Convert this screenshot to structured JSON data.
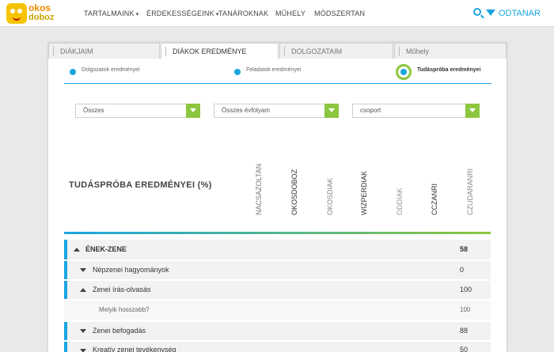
{
  "logo": {
    "word1": "okos",
    "word2": "doboz"
  },
  "nav": {
    "items": [
      "TARTALMAINK",
      "ÉRDEKESSÉGEINK",
      "TANÁROKNAK",
      "MŰHELY",
      "MÓDSZERTAN"
    ],
    "caret": "▾",
    "user": "ODTANAR"
  },
  "tabs": [
    "DIÁKJAIM",
    "DIÁKOK EREDMÉNYE",
    "DOLGOZATAIM",
    "Műhely"
  ],
  "subtabs": [
    "Dolgozatok eredményei",
    "Feladatok eredményei",
    "Tudáspróba eredményei"
  ],
  "filters": [
    "Összes",
    "Összes évfolyam",
    "csoport"
  ],
  "table": {
    "title": "TUDÁSPRÓBA EREDMÉNYEI (%)",
    "columns": [
      "NACSAZOLTAN",
      "OKOSDOBOZ",
      "OKOSDIAK",
      "WIZPERDIAK",
      "ODDIAK",
      "CCZANRI",
      "CZUDARANRI"
    ],
    "rows": [
      {
        "label": "ÉNEK-ZENE",
        "value": "58"
      },
      {
        "label": "Népzenei hagyományok",
        "value": "0"
      },
      {
        "label": "Zenei írás-olvasás",
        "value": "100"
      },
      {
        "label": "Melyik hosszabb?",
        "value": "100"
      },
      {
        "label": "Zenei befogadás",
        "value": "88"
      },
      {
        "label": "Kreatív zenei tevékenység",
        "value": "50"
      }
    ]
  },
  "colors": {
    "accent_blue": "#1aa5e0",
    "accent_green": "#8cc63f"
  }
}
